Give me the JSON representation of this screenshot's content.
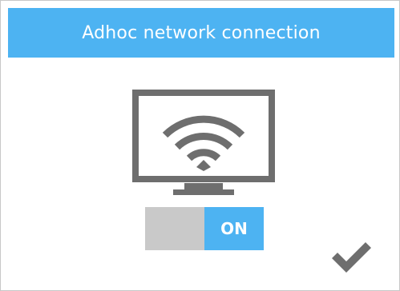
{
  "dialog": {
    "title": "Adhoc network connection"
  },
  "monitor": {
    "icon": "wifi-monitor-icon"
  },
  "toggle": {
    "state": "on",
    "label": "ON"
  },
  "confirm": {
    "icon": "checkmark-icon"
  },
  "colors": {
    "accent": "#4db3f2",
    "toggle_off": "#c9c9c9",
    "icon": "#6e6e6e",
    "background": "#ffffff"
  }
}
